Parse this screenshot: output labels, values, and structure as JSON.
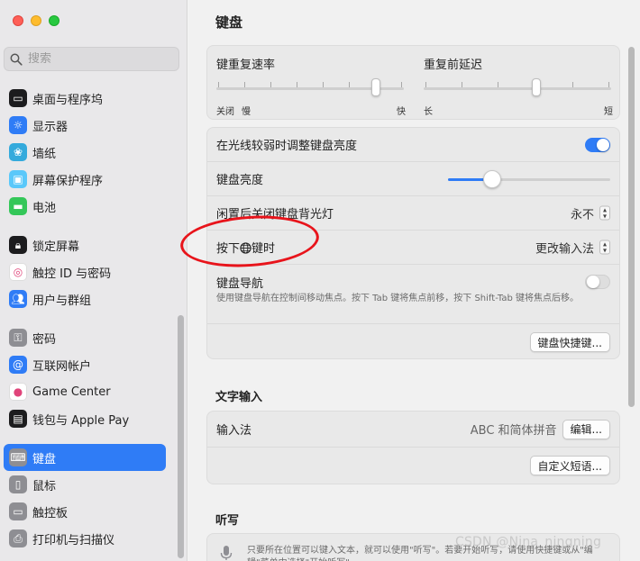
{
  "search": {
    "placeholder": "搜索"
  },
  "sidebar": {
    "groups": [
      [
        {
          "label": "桌面与程序坞",
          "icon": "dock-icon",
          "color": "#1c1c1e"
        },
        {
          "label": "显示器",
          "icon": "display-icon",
          "color": "#2f7cf6"
        },
        {
          "label": "墙纸",
          "icon": "wallpaper-icon",
          "color": "#34aadc"
        },
        {
          "label": "屏幕保护程序",
          "icon": "screensaver-icon",
          "color": "#5ac8fa"
        },
        {
          "label": "电池",
          "icon": "battery-icon",
          "color": "#34c759"
        }
      ],
      [
        {
          "label": "锁定屏幕",
          "icon": "lock-icon",
          "color": "#1c1c1e"
        },
        {
          "label": "触控 ID 与密码",
          "icon": "fingerprint-icon",
          "color": "#ffffff"
        },
        {
          "label": "用户与群组",
          "icon": "users-icon",
          "color": "#2f7cf6"
        }
      ],
      [
        {
          "label": "密码",
          "icon": "key-icon",
          "color": "#8e8e93"
        },
        {
          "label": "互联网帐户",
          "icon": "at-icon",
          "color": "#2f7cf6"
        },
        {
          "label": "Game Center",
          "icon": "game-center-icon",
          "color": "#ffffff"
        },
        {
          "label": "钱包与 Apple Pay",
          "icon": "wallet-icon",
          "color": "#1c1c1e"
        }
      ],
      [
        {
          "label": "键盘",
          "icon": "keyboard-icon",
          "color": "#8e8e93",
          "active": true
        },
        {
          "label": "鼠标",
          "icon": "mouse-icon",
          "color": "#8e8e93"
        },
        {
          "label": "触控板",
          "icon": "trackpad-icon",
          "color": "#8e8e93"
        },
        {
          "label": "打印机与扫描仪",
          "icon": "printer-icon",
          "color": "#8e8e93"
        }
      ]
    ]
  },
  "main": {
    "title": "键盘",
    "repeat_rate": {
      "label": "键重复速率",
      "min": "关闭",
      "mid": "慢",
      "max": "快",
      "level": 0.85
    },
    "repeat_delay": {
      "label": "重复前延迟",
      "min": "长",
      "max": "短",
      "level": 0.6
    },
    "low_light": {
      "label": "在光线较弱时调整键盘亮度",
      "on": true
    },
    "brightness": {
      "label": "键盘亮度",
      "level": 0.27
    },
    "backlight_off": {
      "label": "闲置后关闭键盘背光灯",
      "value": "永不"
    },
    "globe_key": {
      "label_prefix": "按下",
      "label_suffix": "键时",
      "value": "更改输入法"
    },
    "keyboard_nav": {
      "label": "键盘导航",
      "desc": "使用键盘导航在控制间移动焦点。按下 Tab 键将焦点前移，按下 Shift-Tab 键将焦点后移。",
      "on": false
    },
    "shortcuts_button": "键盘快捷键...",
    "text_input": {
      "title": "文字输入",
      "input_label": "输入法",
      "input_value": "ABC 和简体拼音",
      "edit_button": "编辑...",
      "replacements_button": "自定义短语..."
    },
    "dictation": {
      "title": "听写",
      "desc": "只要所在位置可以键入文本，就可以使用\"听写\"。若要开始听写，请使用快捷键或从\"编辑\"菜单中选择\"开始听写\"。"
    }
  },
  "watermark": "CSDN @Nina_ningning"
}
